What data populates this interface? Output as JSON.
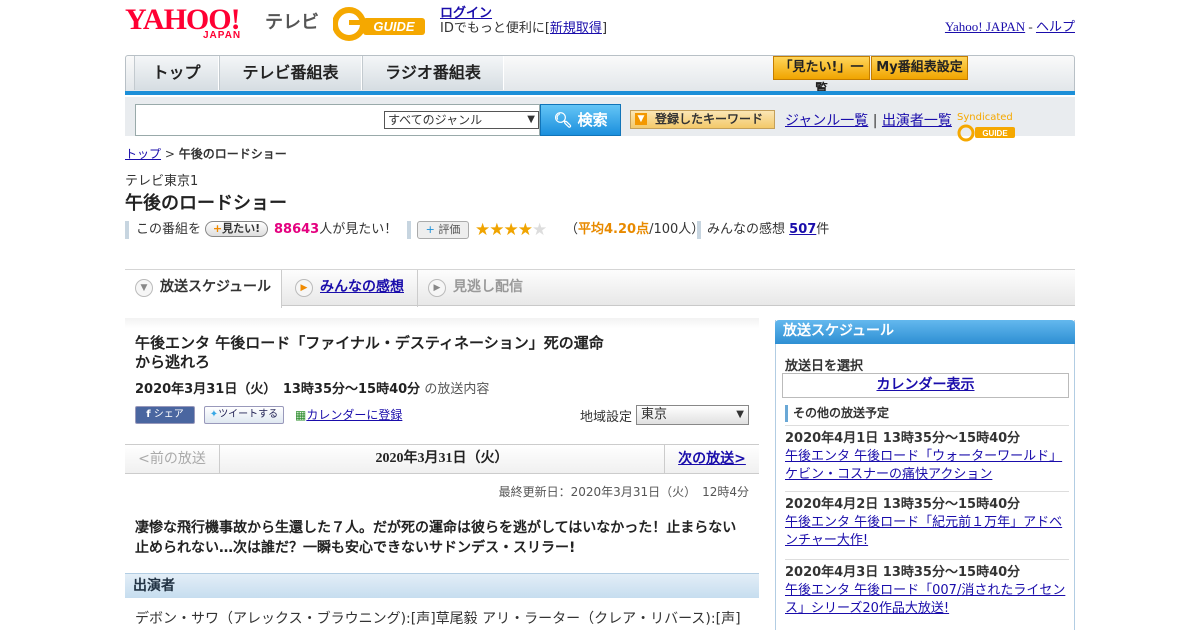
{
  "header": {
    "logo_text": "YAHOO!",
    "logo_sub": "JAPAN",
    "tv_label": "テレビ",
    "gguide": "G-GUIDE",
    "login": "ログイン",
    "id_text": "IDでもっと便利に[",
    "signup": "新規取得",
    "id_close": "]",
    "yahoo_japan": "Yahoo! JAPAN",
    "sep": " - ",
    "help": "ヘルプ"
  },
  "nav": {
    "tabs": [
      "トップ",
      "テレビ番組表",
      "ラジオ番組表"
    ],
    "wanna_list": "「見たい!」一覧",
    "my_settings": "My番組表設定"
  },
  "search": {
    "placeholder": "",
    "genre": "すべてのジャンル",
    "button": "検索",
    "keyword_btn": "登録したキーワード",
    "genre_list": "ジャンル一覧",
    "divider": "|",
    "cast_list": "出演者一覧",
    "syndicated": "Syndicated"
  },
  "breadcrumb": {
    "top": "トップ",
    "sep": " > ",
    "current": "午後のロードショー"
  },
  "program": {
    "channel": "テレビ東京1",
    "title": "午後のロードショー",
    "this_program": "この番組を",
    "mitai": "見たい!",
    "want_count": "88643",
    "want_suffix": "人が見たい！",
    "eval_label": "評価",
    "rating": 4.2,
    "stars_on": "★★★★",
    "stars_off": "★",
    "avg_open": "（",
    "avg_val": "平均4.20点",
    "avg_close": "/100人）",
    "impressions_label": "みんなの感想",
    "impressions_count": "507",
    "impressions_suffix": "件"
  },
  "subtabs": {
    "schedule": "放送スケジュール",
    "impressions": "みんなの感想",
    "vod": "見逃し配信"
  },
  "episode": {
    "title": "午後エンタ 午後ロード「ファイナル・デスティネーション」死の運命から逃れろ",
    "date": "2020年3月31日（火）　13時35分～15時40分",
    "date_suffix": " の放送内容",
    "share": "シェア",
    "tweet": "ツイートする",
    "calendar_reg": "カレンダーに登録",
    "region_label": "地域設定",
    "region": "東京",
    "prev": "<前の放送",
    "current": "2020年3月31日（火）",
    "next": "次の放送>",
    "updated": "最終更新日：2020年3月31日（火）　12時4分",
    "desc": "凄惨な飛行機事故から生還した７人。だが死の運命は彼らを逃がしてはいなかった！止まらない止められない…次は誰だ？一瞬も安心できないサドンデス・スリラー!",
    "cast_header": "出演者",
    "cast": "デボン・サワ（アレックス・ブラウニング):[声]草尾毅 アリ・ラーター（クレア・リバース):[声]"
  },
  "sidebar": {
    "header": "放送スケジュール",
    "select_date": "放送日を選択",
    "calendar": "カレンダー表示",
    "other_header": "その他の放送予定",
    "items": [
      {
        "date": "2020年4月1日  13時35分～15時40分",
        "title": "午後エンタ 午後ロード「ウォーターワールド」ケビン・コスナーの痛快アクション"
      },
      {
        "date": "2020年4月2日  13時35分～15時40分",
        "title": "午後エンタ 午後ロード「紀元前１万年」アドベンチャー大作!"
      },
      {
        "date": "2020年4月3日  13時35分～15時40分",
        "title": "午後エンタ 午後ロード「007/消されたライセンス」シリーズ20作品大放送!"
      }
    ]
  },
  "colors": {
    "accent_blue": "#1c8fd8",
    "brand_red": "#ff0033",
    "gguide_yellow": "#f5a800",
    "pink": "#e4007f"
  }
}
